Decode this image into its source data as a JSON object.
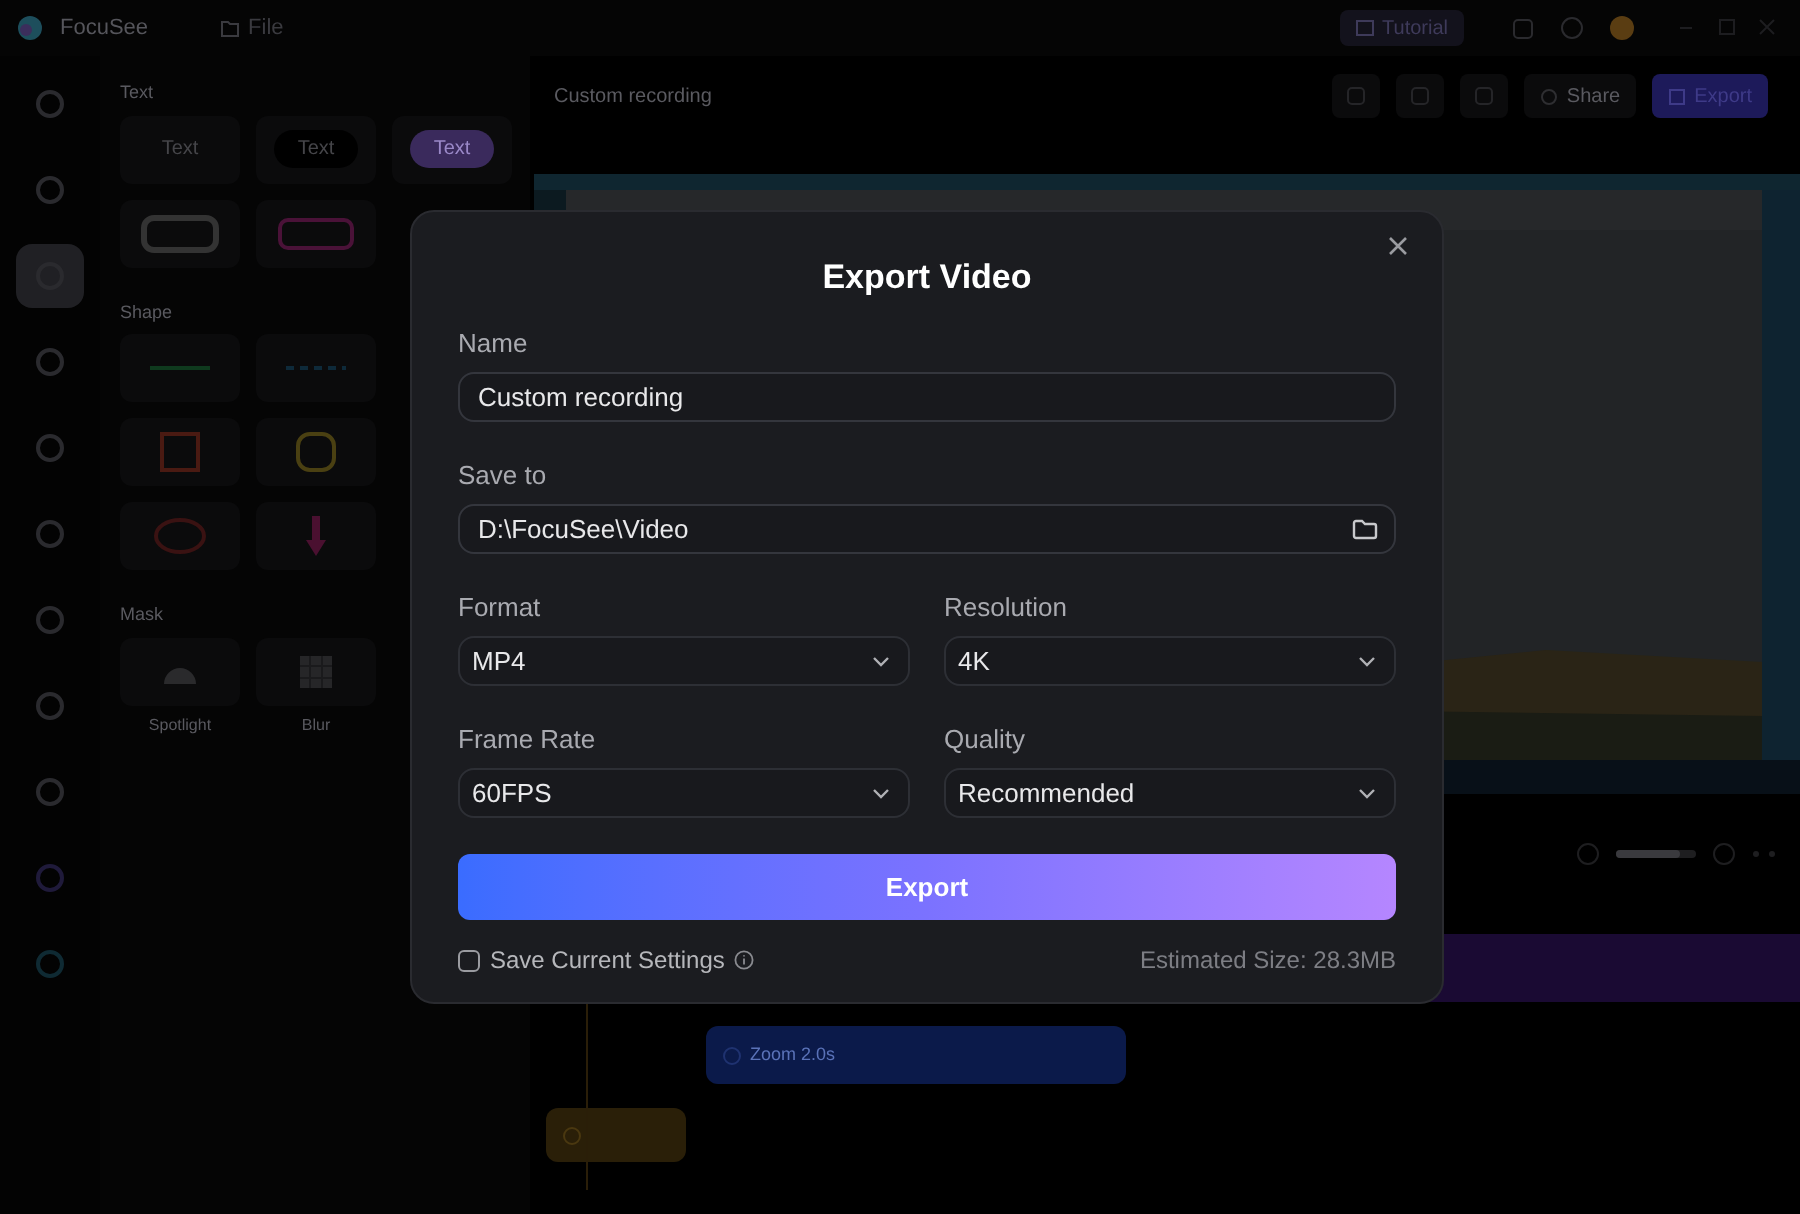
{
  "app": {
    "logo": "FocuSee",
    "menu": "File",
    "tutorial": "Tutorial",
    "project_title": "Custom recording",
    "share_button": "Share",
    "export_button": "Export"
  },
  "rail": [
    {
      "selected": false
    },
    {
      "selected": false
    },
    {
      "selected": true
    },
    {
      "selected": false
    },
    {
      "selected": false
    },
    {
      "selected": false
    },
    {
      "selected": false
    },
    {
      "selected": false
    },
    {
      "selected": false
    },
    {
      "selected": false
    },
    {
      "selected": false
    }
  ],
  "panel": [
    {
      "title": "Text",
      "tiles": [
        {
          "kind": "text_plain",
          "label": "Text"
        },
        {
          "kind": "text_pill",
          "label": "Text"
        },
        {
          "kind": "text_bubble",
          "label": "Text"
        },
        {
          "kind": "text_frame"
        },
        {
          "kind": "text_neon"
        }
      ]
    },
    {
      "title": "Shape",
      "tiles": [
        {
          "kind": "line"
        },
        {
          "kind": "dashed_line"
        },
        {
          "kind": "square"
        },
        {
          "kind": "rounded_square"
        },
        {
          "kind": "circle"
        },
        {
          "kind": "arrow"
        }
      ]
    },
    {
      "title": "Mask",
      "tiles": [
        {
          "kind": "spotlight",
          "caption": "Spotlight"
        },
        {
          "kind": "blur",
          "caption": "Blur"
        }
      ]
    }
  ],
  "timeline": {
    "zoom_level": {
      "level": 0.8
    },
    "clips": [
      {
        "kind": "zoom",
        "label": "Zoom  2.0s"
      },
      {
        "kind": "marker"
      }
    ]
  },
  "dialog": {
    "title": "Export Video",
    "fields": [
      {
        "kind": "text",
        "label": "Name",
        "value": "Custom recording"
      },
      {
        "kind": "folder",
        "label": "Save to",
        "value": "D:\\FocuSee\\Video"
      }
    ],
    "selects": [
      {
        "label": "Format",
        "value": "MP4"
      },
      {
        "label": "Resolution",
        "value": "4K"
      },
      {
        "label": "Frame Rate",
        "value": "60FPS"
      },
      {
        "label": "Quality",
        "value": "Recommended"
      }
    ],
    "export_button": "Export",
    "save_settings": {
      "label": "Save Current Settings",
      "checked": false
    },
    "estimate": "Estimated Size: 28.3MB"
  }
}
